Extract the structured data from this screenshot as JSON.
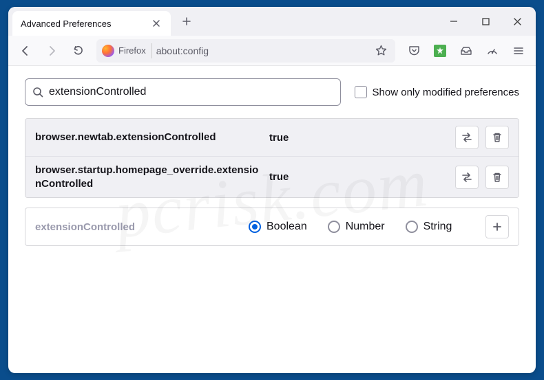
{
  "window": {
    "tab_title": "Advanced Preferences"
  },
  "toolbar": {
    "identity_label": "Firefox",
    "url": "about:config"
  },
  "search": {
    "value": "extensionControlled",
    "checkbox_label": "Show only modified preferences"
  },
  "prefs": [
    {
      "name": "browser.newtab.extensionControlled",
      "value": "true"
    },
    {
      "name": "browser.startup.homepage_override.extensionControlled",
      "value": "true"
    }
  ],
  "new_pref": {
    "name": "extensionControlled",
    "type_options": {
      "boolean": "Boolean",
      "number": "Number",
      "string": "String"
    },
    "selected": "boolean"
  },
  "watermark": "pcrisk.com"
}
